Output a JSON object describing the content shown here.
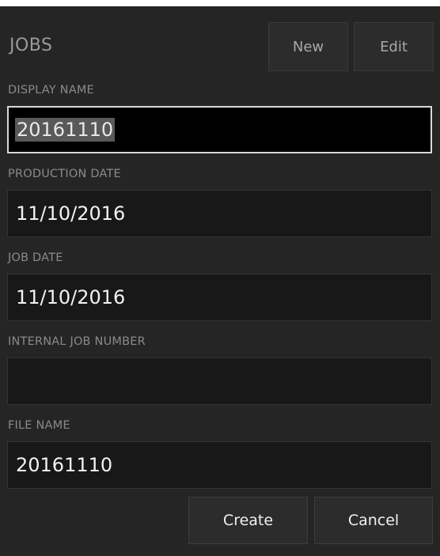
{
  "header": {
    "title": "JOBS",
    "new_label": "New",
    "edit_label": "Edit"
  },
  "fields": {
    "display_name": {
      "label": "DISPLAY NAME",
      "value": "20161110"
    },
    "production_date": {
      "label": "PRODUCTION DATE",
      "value": "11/10/2016"
    },
    "job_date": {
      "label": "JOB DATE",
      "value": "11/10/2016"
    },
    "internal_job_number": {
      "label": "INTERNAL JOB NUMBER",
      "value": ""
    },
    "file_name": {
      "label": "FILE NAME",
      "value": "20161110"
    }
  },
  "actions": {
    "create_label": "Create",
    "cancel_label": "Cancel"
  }
}
